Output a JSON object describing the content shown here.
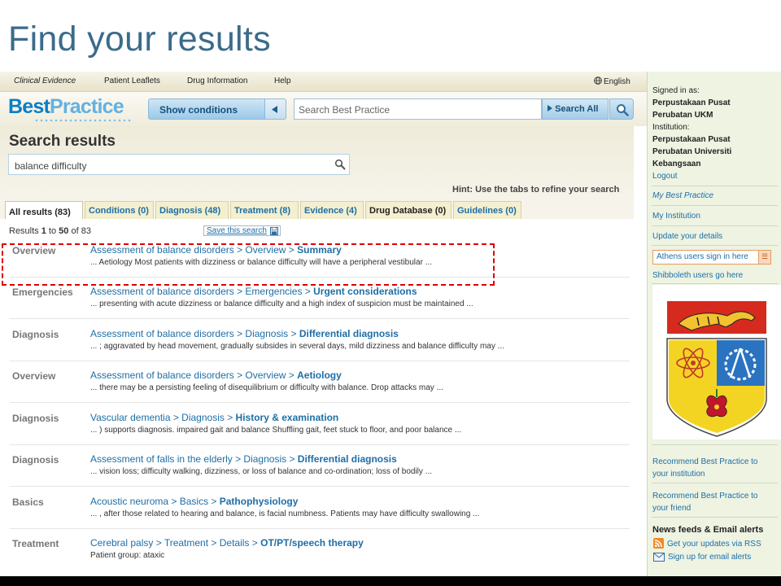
{
  "slide": {
    "title": "Find your results"
  },
  "topnav": {
    "items": [
      "Clinical Evidence",
      "Patient Leaflets",
      "Drug Information",
      "Help"
    ],
    "language": "English"
  },
  "header": {
    "logo": {
      "best": "Best",
      "practice": "Practice"
    },
    "show_conditions": "Show conditions",
    "search_placeholder": "Search Best Practice",
    "search_all": "Search All"
  },
  "results": {
    "heading": "Search results",
    "query": "balance difficulty",
    "hint": "Hint: Use the tabs to refine your search",
    "tabs": [
      {
        "label": "All results (83)",
        "active": true
      },
      {
        "label": "Conditions (0)"
      },
      {
        "label": "Diagnosis (48)"
      },
      {
        "label": "Treatment (8)"
      },
      {
        "label": "Evidence (4)"
      },
      {
        "label": "Drug Database (0)"
      },
      {
        "label": "Guidelines (0)"
      }
    ],
    "count": {
      "prefix": "Results ",
      "from": "1",
      "mid": " to ",
      "to": "50",
      "of": " of ",
      "total": "83"
    },
    "save_search": "Save this search",
    "items": [
      {
        "category": "Overview",
        "path": "Assessment of balance disorders > Overview > ",
        "section": "Summary",
        "snippet": "... Aetiology Most patients with dizziness or balance difficulty will have a peripheral vestibular ..."
      },
      {
        "category": "Emergencies",
        "path": "Assessment of balance disorders > Emergencies > ",
        "section": "Urgent considerations",
        "snippet": "... presenting with acute dizziness or balance difficulty and a high index of suspicion must be maintained ..."
      },
      {
        "category": "Diagnosis",
        "path": "Assessment of balance disorders > Diagnosis > ",
        "section": "Differential diagnosis",
        "snippet": "... ; aggravated by head movement, gradually subsides in several days, mild dizziness and balance difficulty may ..."
      },
      {
        "category": "Overview",
        "path": "Assessment of balance disorders > Overview > ",
        "section": "Aetiology",
        "snippet": "... there may be a persisting feeling of disequilibrium or difficulty with balance. Drop attacks may ..."
      },
      {
        "category": "Diagnosis",
        "path": "Vascular dementia > Diagnosis > ",
        "section": "History & examination",
        "snippet": "... ) supports diagnosis. impaired gait and balance Shuffling gait, feet stuck to floor, and poor balance ..."
      },
      {
        "category": "Diagnosis",
        "path": "Assessment of falls in the elderly > Diagnosis > ",
        "section": "Differential diagnosis",
        "snippet": "... vision loss; difficulty walking, dizziness, or loss of balance and co-ordination; loss of bodily ..."
      },
      {
        "category": "Basics",
        "path": "Acoustic neuroma > Basics > ",
        "section": "Pathophysiology",
        "snippet": "... , after those related to hearing and balance, is facial numbness. Patients may have difficulty swallowing ..."
      },
      {
        "category": "Treatment",
        "path": "Cerebral palsy > Treatment > Details > ",
        "section": "OT/PT/speech therapy",
        "snippet": "Patient group: ataxic"
      }
    ]
  },
  "sidebar": {
    "signed_in_as": "Signed in as:",
    "user_line1": "Perpustakaan Pusat",
    "user_line2": "Perubatan UKM",
    "institution_label": "Institution:",
    "inst_line1": "Perpustakaan Pusat",
    "inst_line2": "Perubatan Universiti",
    "inst_line3": "Kebangsaan",
    "logout": "Logout",
    "my_bp": "My Best Practice",
    "my_institution": "My Institution",
    "update_details": "Update your details",
    "athens": "Athens users sign in here",
    "shibboleth": "Shibboleth users go here",
    "recommend_inst": "Recommend Best Practice to your institution",
    "recommend_friend": "Recommend Best Practice to your friend",
    "news_heading": "News feeds & Email alerts",
    "rss": "Get your updates via RSS",
    "email": "Sign up for email alerts"
  },
  "colors": {
    "link": "#1e6ea6",
    "slide_title": "#3b6b8a",
    "highlight": "#e00000"
  }
}
